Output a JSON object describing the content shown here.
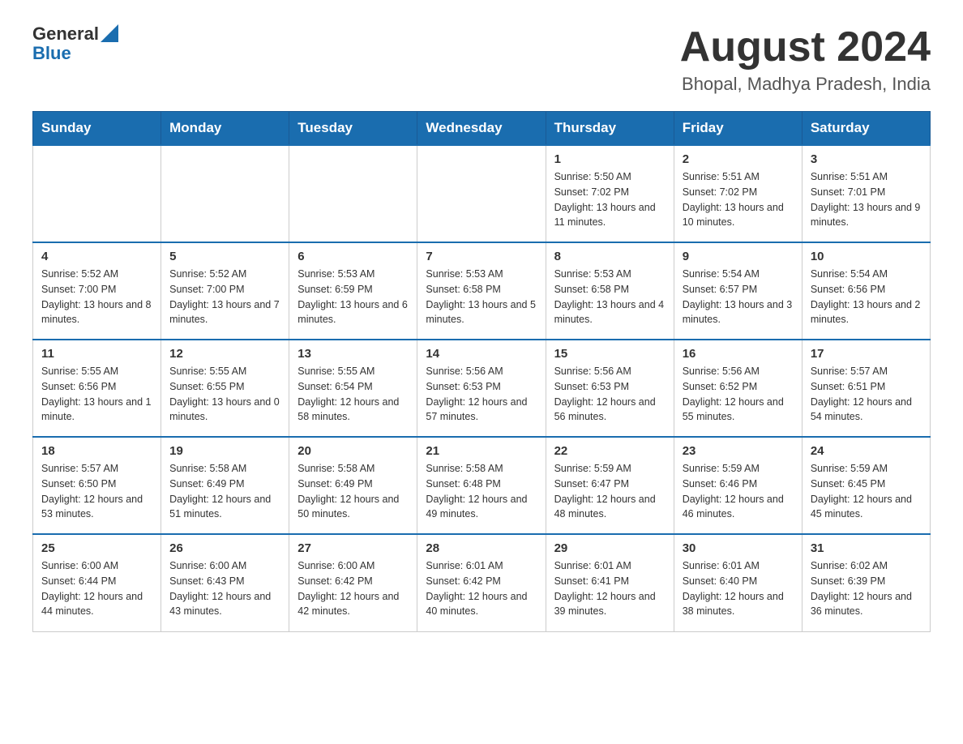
{
  "header": {
    "logo": {
      "general": "General",
      "blue": "Blue"
    },
    "title": "August 2024",
    "subtitle": "Bhopal, Madhya Pradesh, India"
  },
  "weekdays": [
    "Sunday",
    "Monday",
    "Tuesday",
    "Wednesday",
    "Thursday",
    "Friday",
    "Saturday"
  ],
  "weeks": [
    {
      "days": [
        {
          "num": "",
          "info": ""
        },
        {
          "num": "",
          "info": ""
        },
        {
          "num": "",
          "info": ""
        },
        {
          "num": "",
          "info": ""
        },
        {
          "num": "1",
          "info": "Sunrise: 5:50 AM\nSunset: 7:02 PM\nDaylight: 13 hours and 11 minutes."
        },
        {
          "num": "2",
          "info": "Sunrise: 5:51 AM\nSunset: 7:02 PM\nDaylight: 13 hours and 10 minutes."
        },
        {
          "num": "3",
          "info": "Sunrise: 5:51 AM\nSunset: 7:01 PM\nDaylight: 13 hours and 9 minutes."
        }
      ]
    },
    {
      "days": [
        {
          "num": "4",
          "info": "Sunrise: 5:52 AM\nSunset: 7:00 PM\nDaylight: 13 hours and 8 minutes."
        },
        {
          "num": "5",
          "info": "Sunrise: 5:52 AM\nSunset: 7:00 PM\nDaylight: 13 hours and 7 minutes."
        },
        {
          "num": "6",
          "info": "Sunrise: 5:53 AM\nSunset: 6:59 PM\nDaylight: 13 hours and 6 minutes."
        },
        {
          "num": "7",
          "info": "Sunrise: 5:53 AM\nSunset: 6:58 PM\nDaylight: 13 hours and 5 minutes."
        },
        {
          "num": "8",
          "info": "Sunrise: 5:53 AM\nSunset: 6:58 PM\nDaylight: 13 hours and 4 minutes."
        },
        {
          "num": "9",
          "info": "Sunrise: 5:54 AM\nSunset: 6:57 PM\nDaylight: 13 hours and 3 minutes."
        },
        {
          "num": "10",
          "info": "Sunrise: 5:54 AM\nSunset: 6:56 PM\nDaylight: 13 hours and 2 minutes."
        }
      ]
    },
    {
      "days": [
        {
          "num": "11",
          "info": "Sunrise: 5:55 AM\nSunset: 6:56 PM\nDaylight: 13 hours and 1 minute."
        },
        {
          "num": "12",
          "info": "Sunrise: 5:55 AM\nSunset: 6:55 PM\nDaylight: 13 hours and 0 minutes."
        },
        {
          "num": "13",
          "info": "Sunrise: 5:55 AM\nSunset: 6:54 PM\nDaylight: 12 hours and 58 minutes."
        },
        {
          "num": "14",
          "info": "Sunrise: 5:56 AM\nSunset: 6:53 PM\nDaylight: 12 hours and 57 minutes."
        },
        {
          "num": "15",
          "info": "Sunrise: 5:56 AM\nSunset: 6:53 PM\nDaylight: 12 hours and 56 minutes."
        },
        {
          "num": "16",
          "info": "Sunrise: 5:56 AM\nSunset: 6:52 PM\nDaylight: 12 hours and 55 minutes."
        },
        {
          "num": "17",
          "info": "Sunrise: 5:57 AM\nSunset: 6:51 PM\nDaylight: 12 hours and 54 minutes."
        }
      ]
    },
    {
      "days": [
        {
          "num": "18",
          "info": "Sunrise: 5:57 AM\nSunset: 6:50 PM\nDaylight: 12 hours and 53 minutes."
        },
        {
          "num": "19",
          "info": "Sunrise: 5:58 AM\nSunset: 6:49 PM\nDaylight: 12 hours and 51 minutes."
        },
        {
          "num": "20",
          "info": "Sunrise: 5:58 AM\nSunset: 6:49 PM\nDaylight: 12 hours and 50 minutes."
        },
        {
          "num": "21",
          "info": "Sunrise: 5:58 AM\nSunset: 6:48 PM\nDaylight: 12 hours and 49 minutes."
        },
        {
          "num": "22",
          "info": "Sunrise: 5:59 AM\nSunset: 6:47 PM\nDaylight: 12 hours and 48 minutes."
        },
        {
          "num": "23",
          "info": "Sunrise: 5:59 AM\nSunset: 6:46 PM\nDaylight: 12 hours and 46 minutes."
        },
        {
          "num": "24",
          "info": "Sunrise: 5:59 AM\nSunset: 6:45 PM\nDaylight: 12 hours and 45 minutes."
        }
      ]
    },
    {
      "days": [
        {
          "num": "25",
          "info": "Sunrise: 6:00 AM\nSunset: 6:44 PM\nDaylight: 12 hours and 44 minutes."
        },
        {
          "num": "26",
          "info": "Sunrise: 6:00 AM\nSunset: 6:43 PM\nDaylight: 12 hours and 43 minutes."
        },
        {
          "num": "27",
          "info": "Sunrise: 6:00 AM\nSunset: 6:42 PM\nDaylight: 12 hours and 42 minutes."
        },
        {
          "num": "28",
          "info": "Sunrise: 6:01 AM\nSunset: 6:42 PM\nDaylight: 12 hours and 40 minutes."
        },
        {
          "num": "29",
          "info": "Sunrise: 6:01 AM\nSunset: 6:41 PM\nDaylight: 12 hours and 39 minutes."
        },
        {
          "num": "30",
          "info": "Sunrise: 6:01 AM\nSunset: 6:40 PM\nDaylight: 12 hours and 38 minutes."
        },
        {
          "num": "31",
          "info": "Sunrise: 6:02 AM\nSunset: 6:39 PM\nDaylight: 12 hours and 36 minutes."
        }
      ]
    }
  ]
}
